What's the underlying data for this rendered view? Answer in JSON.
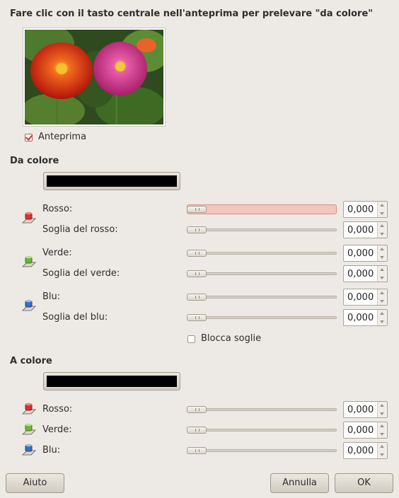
{
  "header": {
    "instruction": "Fare clic con il tasto centrale nell'anteprima per prelevare \"da colore\""
  },
  "preview": {
    "checkbox_label": "Anteprima",
    "checked": true
  },
  "from_color": {
    "title": "Da colore",
    "swatch_color": "#000000",
    "rows": [
      {
        "label": "Rosso:",
        "value": "0,000",
        "level": 0
      },
      {
        "label": "Soglia del rosso:",
        "value": "0,000",
        "level": 0
      },
      {
        "label": "Verde:",
        "value": "0,000",
        "level": 0
      },
      {
        "label": "Soglia del verde:",
        "value": "0,000",
        "level": 0
      },
      {
        "label": "Blu:",
        "value": "0,000",
        "level": 0
      },
      {
        "label": "Soglia del blu:",
        "value": "0,000",
        "level": 0
      }
    ],
    "lock_thresholds": {
      "label": "Blocca soglie",
      "checked": false
    }
  },
  "to_color": {
    "title": "A colore",
    "swatch_color": "#000000",
    "rows": [
      {
        "label": "Rosso:",
        "value": "0,000",
        "level": 0
      },
      {
        "label": "Verde:",
        "value": "0,000",
        "level": 0
      },
      {
        "label": "Blu:",
        "value": "0,000",
        "level": 0
      }
    ]
  },
  "buttons": {
    "help": "Aiuto",
    "cancel": "Annulla",
    "ok": "OK"
  },
  "icons": {
    "red_channel": "red-chain-icon",
    "green_channel": "green-chain-icon",
    "blue_channel": "blue-chain-icon"
  },
  "colors": {
    "red": "#c7272b",
    "green": "#5aa02c",
    "blue": "#3465a4",
    "focus_track": "#f1c7bd"
  }
}
